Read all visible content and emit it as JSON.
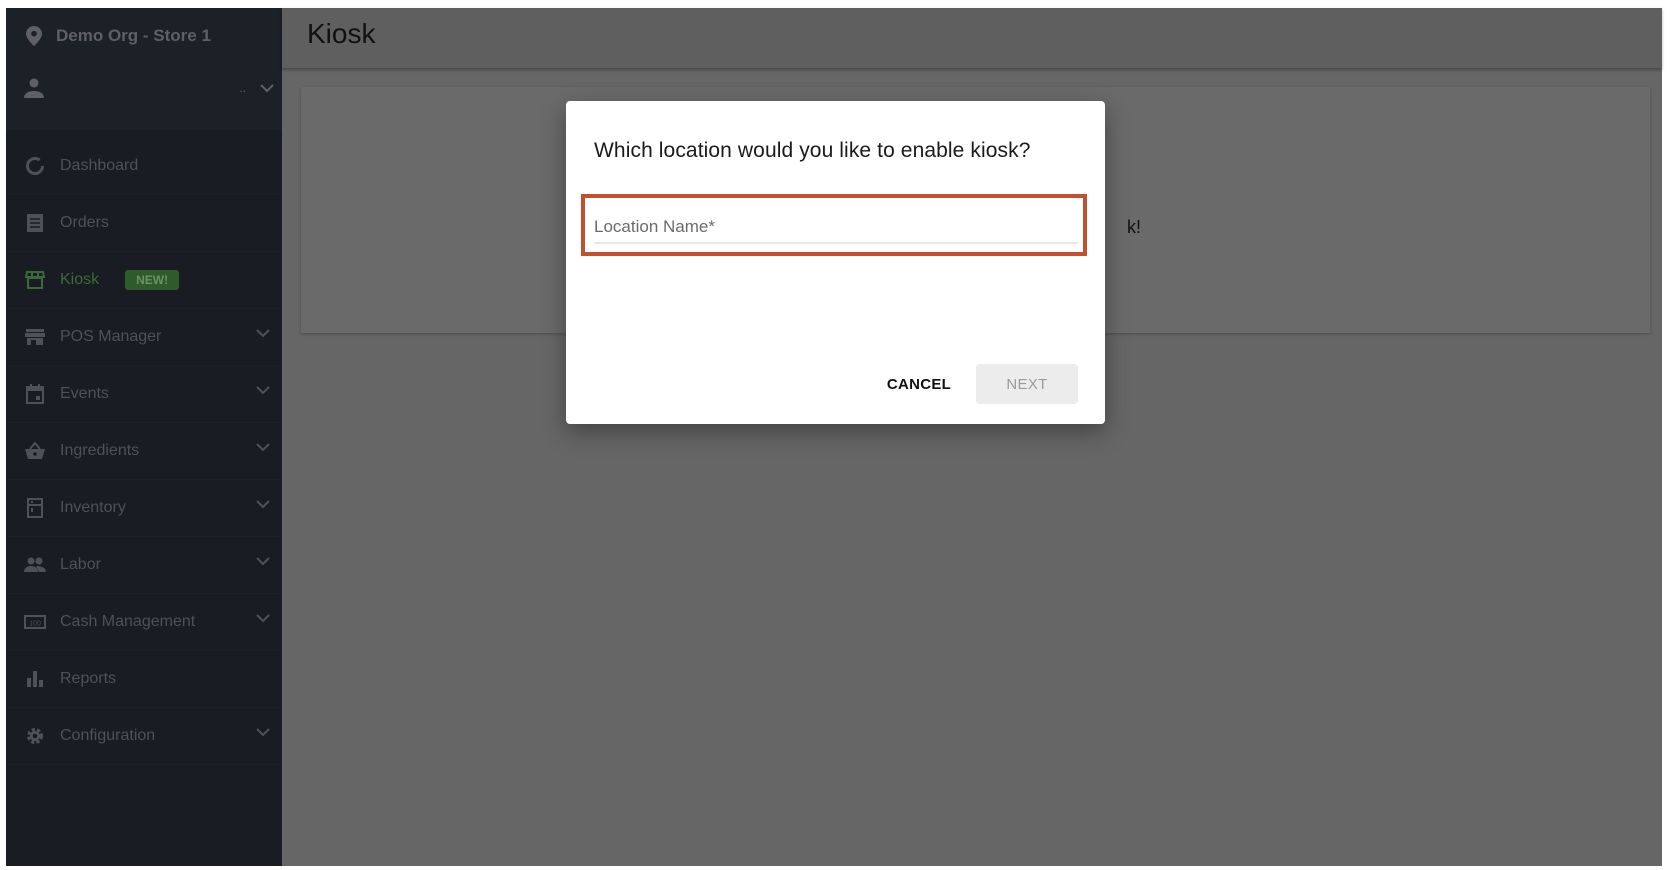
{
  "sidebar": {
    "org": "Demo Org - Store 1",
    "user_name": "..",
    "items": [
      {
        "label": "Dashboard",
        "icon": "donut-icon",
        "expandable": false
      },
      {
        "label": "Orders",
        "icon": "receipt-icon",
        "expandable": false
      },
      {
        "label": "Kiosk",
        "icon": "storefront-icon",
        "expandable": false,
        "active": true,
        "badge": "NEW!"
      },
      {
        "label": "POS Manager",
        "icon": "store-icon",
        "expandable": true
      },
      {
        "label": "Events",
        "icon": "calendar-icon",
        "expandable": true
      },
      {
        "label": "Ingredients",
        "icon": "basket-icon",
        "expandable": true
      },
      {
        "label": "Inventory",
        "icon": "fridge-icon",
        "expandable": true
      },
      {
        "label": "Labor",
        "icon": "people-icon",
        "expandable": true
      },
      {
        "label": "Cash Management",
        "icon": "money-icon",
        "expandable": true
      },
      {
        "label": "Reports",
        "icon": "bar-chart-icon",
        "expandable": false
      },
      {
        "label": "Configuration",
        "icon": "gear-icon",
        "expandable": true
      }
    ]
  },
  "header": {
    "title": "Kiosk"
  },
  "card": {
    "partial_text": "k!"
  },
  "dialog": {
    "title": "Which location would you like to enable kiosk?",
    "field": {
      "placeholder": "Location Name*",
      "value": ""
    },
    "cancel_label": "CANCEL",
    "next_label": "NEXT",
    "next_disabled": true
  },
  "colors": {
    "accent_green": "#3b6a38",
    "highlight_border": "#c2502e",
    "sidebar_bg": "#191c22"
  }
}
